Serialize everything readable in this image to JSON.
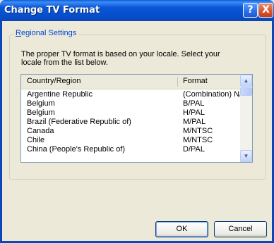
{
  "window": {
    "title": "Change TV Format",
    "help_glyph": "?",
    "close_glyph": "X"
  },
  "group": {
    "label": "Regional Settings"
  },
  "description": "The proper TV format is based on your locale. Select your locale from the list below.",
  "list": {
    "columns": [
      "Country/Region",
      "Format"
    ],
    "rows": [
      {
        "country": "Argentine Republic",
        "format": "(Combination) N/P..."
      },
      {
        "country": "Belgium",
        "format": "B/PAL"
      },
      {
        "country": "Belgium",
        "format": "H/PAL"
      },
      {
        "country": "Brazil (Federative Republic of)",
        "format": "M/PAL"
      },
      {
        "country": "Canada",
        "format": "M/NTSC"
      },
      {
        "country": "Chile",
        "format": "M/NTSC"
      },
      {
        "country": "China (People's Republic of)",
        "format": "D/PAL"
      }
    ]
  },
  "buttons": {
    "ok": "OK",
    "cancel": "Cancel"
  },
  "icons": {
    "scroll_up": "▲",
    "scroll_down": "▼"
  }
}
